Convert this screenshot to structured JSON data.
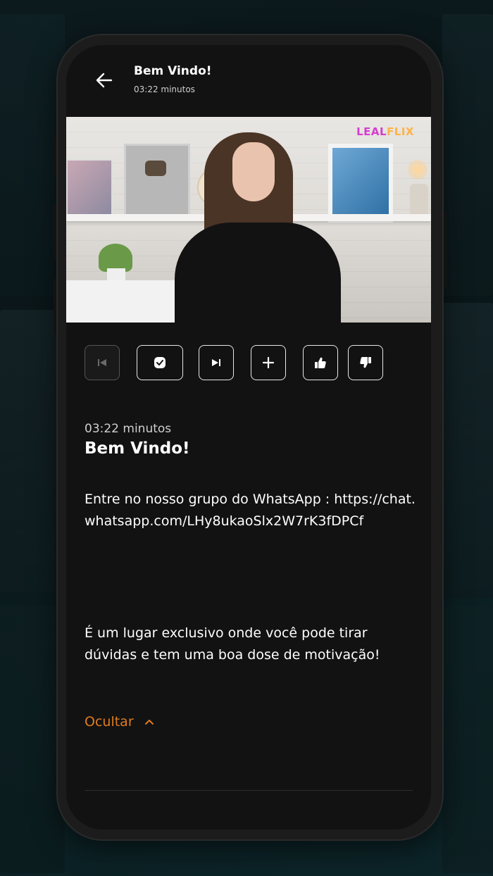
{
  "header": {
    "title": "Bem Vindo!",
    "subtitle": "03:22 minutos"
  },
  "video": {
    "watermark_left": "LEAL",
    "watermark_right": "FLIX"
  },
  "actions": [
    {
      "name": "previous",
      "icon": "skip-previous-icon",
      "enabled": false
    },
    {
      "name": "mark-complete",
      "icon": "check-badge-icon",
      "enabled": true
    },
    {
      "name": "next",
      "icon": "skip-next-icon",
      "enabled": true
    },
    {
      "name": "add",
      "icon": "plus-icon",
      "enabled": true
    },
    {
      "name": "like",
      "icon": "thumbs-up-icon",
      "enabled": true
    },
    {
      "name": "dislike",
      "icon": "thumbs-down-icon",
      "enabled": true
    }
  ],
  "lesson": {
    "duration": "03:22 minutos",
    "title": "Bem Vindo!",
    "description_line_1": "Entre no nosso grupo do WhatsApp : https://chat.whatsapp.com/LHy8ukaoSlx2W7rK3fDPCf",
    "description_line_2": "É um lugar exclusivo onde você pode tirar dúvidas e tem uma boa dose de motivação!"
  },
  "toggle": {
    "label": "Ocultar"
  },
  "colors": {
    "accent": "#e07b20",
    "screen_bg": "#121212",
    "text": "#ffffff"
  }
}
